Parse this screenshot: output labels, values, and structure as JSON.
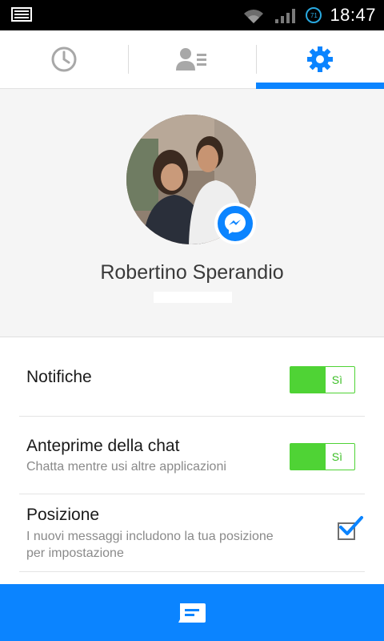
{
  "status_bar": {
    "time": "18:47",
    "battery_level": "71",
    "icons": [
      "keyboard-icon",
      "wifi-icon",
      "signal-icon",
      "battery-icon"
    ]
  },
  "tabs": [
    {
      "name": "recent",
      "icon": "clock-icon",
      "active": false
    },
    {
      "name": "contacts",
      "icon": "contact-card-icon",
      "active": false
    },
    {
      "name": "settings",
      "icon": "gear-icon",
      "active": true
    }
  ],
  "profile": {
    "name": "Robertino Sperandio",
    "badge_icon": "messenger-icon"
  },
  "settings": {
    "notifications": {
      "title": "Notifiche",
      "toggle_label": "Sì",
      "enabled": true
    },
    "chat_previews": {
      "title": "Anteprime della chat",
      "subtitle": "Chatta mentre usi altre applicazioni",
      "toggle_label": "Sì",
      "enabled": true
    },
    "location": {
      "title": "Posizione",
      "subtitle_line1": "I nuovi messaggi includono la tua posizione",
      "subtitle_line2": "per impostazione",
      "checked": true
    }
  },
  "bottom_bar": {
    "icon": "compose-message-icon"
  },
  "colors": {
    "accent": "#0b84ff",
    "toggle_on": "#4fd335",
    "status_bar": "#000000"
  }
}
